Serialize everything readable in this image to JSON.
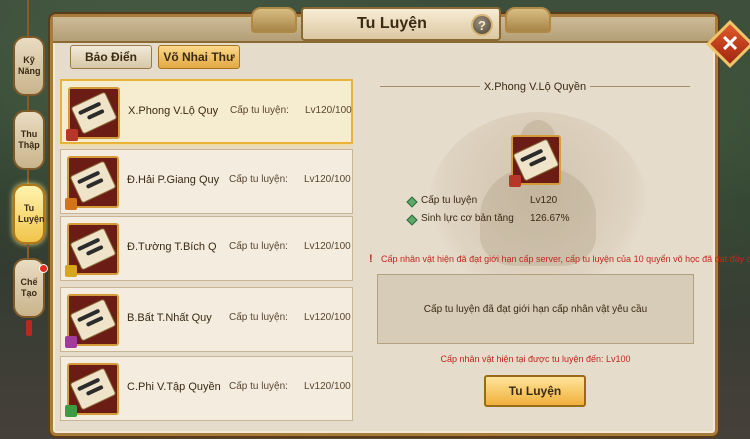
{
  "window": {
    "title": "Tu Luyện",
    "help_label": "?",
    "close_label": "✕"
  },
  "side_tabs": [
    {
      "label": "Kỹ Năng",
      "active": false
    },
    {
      "label": "Thu Thập",
      "active": false
    },
    {
      "label": "Tu Luyện",
      "active": true
    },
    {
      "label": "Chế Tạo",
      "active": false,
      "badge": true
    }
  ],
  "top_tabs": [
    {
      "label": "Bảo Điển",
      "active": false
    },
    {
      "label": "Võ Nhai Thư",
      "active": true
    }
  ],
  "skills": [
    {
      "name": "X.Phong V.Lộ Quy",
      "level_label": "Cấp tu luyện:",
      "level_value": "Lv120/100",
      "selected": true,
      "ribbon": "#b8352a"
    },
    {
      "name": "Đ.Hải P.Giang Quy",
      "level_label": "Cấp tu luyện:",
      "level_value": "Lv120/100",
      "selected": false,
      "ribbon": "#d2741d"
    },
    {
      "name": "Đ.Tường T.Bích Q",
      "level_label": "Cấp tu luyện:",
      "level_value": "Lv120/100",
      "selected": false,
      "ribbon": "#d6a61e"
    },
    {
      "name": "B.Bất T.Nhất Quy",
      "level_label": "Cấp tu luyện:",
      "level_value": "Lv120/100",
      "selected": false,
      "ribbon": "#a23b9b"
    },
    {
      "name": "C.Phi V.Tập Quyền",
      "level_label": "Cấp tu luyện:",
      "level_value": "Lv120/100",
      "selected": false,
      "ribbon": "#3f9a44"
    }
  ],
  "detail": {
    "name": "X.Phong V.Lộ Quyền",
    "stats": [
      {
        "label": "Cấp tu luyện",
        "value": "Lv120"
      },
      {
        "label": "Sinh lực cơ bản tăng",
        "value": "126.67%"
      }
    ],
    "warning_mark": "!",
    "warning": "Cấp nhân vật hiện đã đạt giới hạn cấp server, cấp tu luyện của 10 quyển võ học đã đạt đầy cấp",
    "info": "Cấp tu luyện đã đạt giới hạn cấp nhân vật yêu cầu",
    "requirement": "Cấp nhân vật hiện tại được tu luyện đến: Lv100",
    "button_label": "Tu Luyện"
  },
  "colors": {
    "frame_bg": "#e6dccb",
    "accent_gold": "#f0b03c",
    "warning_red": "#c0281d",
    "selected_border": "#e9b33a"
  }
}
